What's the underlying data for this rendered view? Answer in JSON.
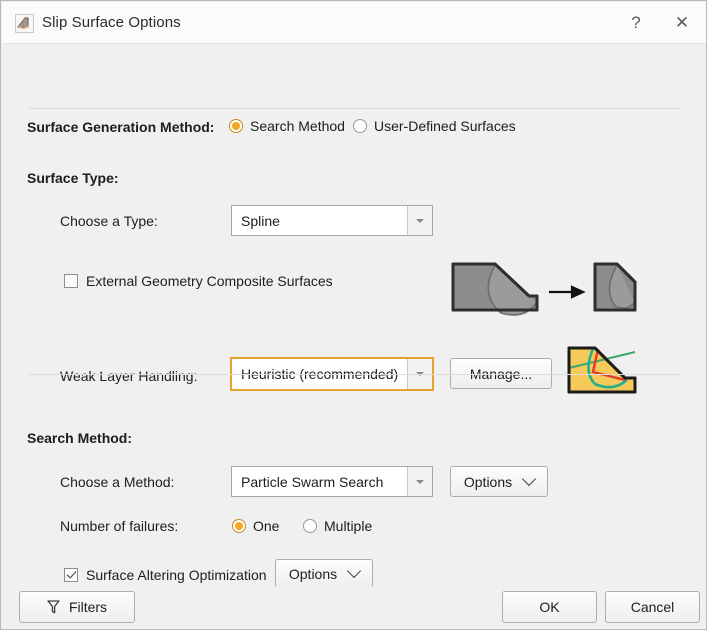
{
  "window": {
    "title": "Slip Surface Options",
    "icon": "slip-surface-icon",
    "help_label": "?",
    "close_label": "✕"
  },
  "surface_generation": {
    "label": "Surface Generation Method:",
    "options": [
      {
        "label": "Search Method",
        "selected": true
      },
      {
        "label": "User-Defined Surfaces",
        "selected": false
      }
    ]
  },
  "surface_type": {
    "group_label": "Surface Type:",
    "choose_type": {
      "label": "Choose a Type:",
      "value": "Spline",
      "options": [
        "Spline"
      ]
    },
    "external_geometry": {
      "label": "External Geometry Composite Surfaces",
      "checked": false
    },
    "composite_graphic": "slope-composite-before-after-icon",
    "weak_layer": {
      "label": "Weak Layer Handling:",
      "value": "Heuristic (recommended)",
      "options": [
        "Heuristic (recommended)"
      ],
      "highlight_color": "#e0a32e"
    },
    "manage_button": "Manage...",
    "weak_layer_graphic": "slope-weak-layer-icon"
  },
  "search_method": {
    "group_label": "Search Method:",
    "choose_method": {
      "label": "Choose a Method:",
      "value": "Particle Swarm Search",
      "options": [
        "Particle Swarm Search"
      ]
    },
    "method_options_button": "Options",
    "number_of_failures": {
      "label": "Number of failures:",
      "options": [
        {
          "label": "One",
          "selected": true
        },
        {
          "label": "Multiple",
          "selected": false
        }
      ]
    },
    "surface_altering": {
      "label": "Surface Altering Optimization",
      "checked": true,
      "options_button": "Options"
    }
  },
  "footer": {
    "filters_button": "Filters",
    "ok_button": "OK",
    "cancel_button": "Cancel"
  },
  "colors": {
    "accent_radio": "#f5a623",
    "highlight_border": "#e0a32e",
    "dialog_bg": "#f0f0f0",
    "titlebar_bg": "#fbfbfb"
  }
}
